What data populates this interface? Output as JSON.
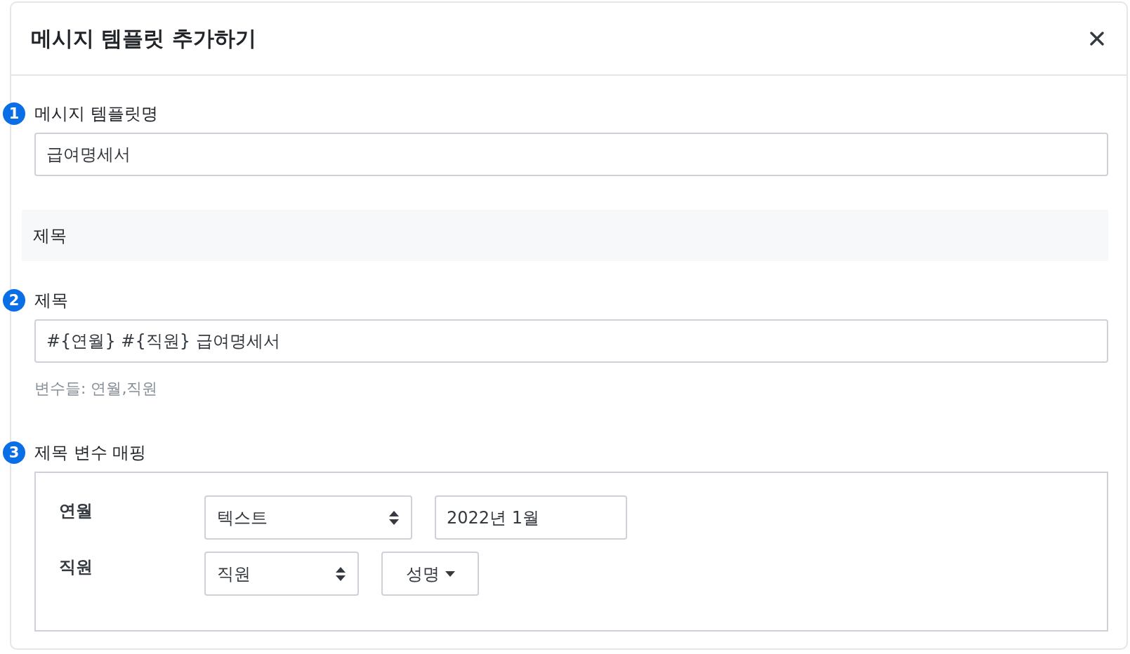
{
  "dialog": {
    "title": "메시지 템플릿 추가하기"
  },
  "template_name": {
    "step": "1",
    "label": "메시지 템플릿명",
    "value": "급여명세서"
  },
  "section": {
    "title": "제목"
  },
  "subject": {
    "step": "2",
    "label": "제목",
    "value": "#{연월} #{직원} 급여명세서",
    "hint": "변수들: 연월,직원"
  },
  "mapping": {
    "step": "3",
    "label": "제목 변수 매핑",
    "rows": [
      {
        "name": "연월",
        "type": "텍스트",
        "kind": "text",
        "value": "2022년 1월"
      },
      {
        "name": "직원",
        "type": "직원",
        "kind": "field",
        "field": "성명"
      }
    ]
  }
}
